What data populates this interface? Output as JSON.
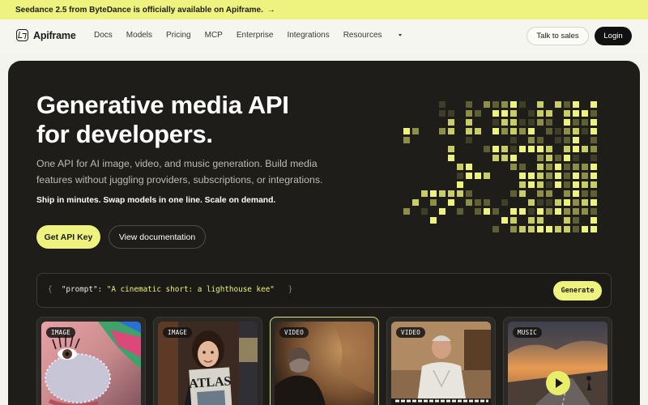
{
  "announcement": {
    "text": "Seedance 2.5 from ByteDance is officially available on Apiframe.",
    "arrow": "→"
  },
  "nav": {
    "brand": "Apiframe",
    "links": [
      "Docs",
      "Models",
      "Pricing",
      "MCP",
      "Enterprise",
      "Integrations",
      "Resources"
    ],
    "talk_to_sales": "Talk to sales",
    "login": "Login"
  },
  "hero": {
    "title_line1": "Generative media API",
    "title_line2": "for developers.",
    "subtitle": "One API for AI image, video, and music generation. Build media features without juggling providers, subscriptions, or integrations.",
    "tagline": "Ship in minutes. Swap models in one line. Scale on demand.",
    "primary_button": "Get API Key",
    "secondary_button": "View documentation"
  },
  "prompt": {
    "open_brace": "{",
    "key": "\"prompt\":",
    "value": "\"A cinematic short: a lighthouse kee\"",
    "close_brace": "}",
    "generate_button": "Generate"
  },
  "cards": [
    {
      "badge": "IMAGE",
      "subject": "face-glitter-portrait"
    },
    {
      "badge": "IMAGE",
      "subject": "woman-holding-atlas-magazine",
      "magazine_text": "ATLAS"
    },
    {
      "badge": "VIDEO",
      "subject": "man-in-cave",
      "active": true
    },
    {
      "badge": "VIDEO",
      "subject": "older-man-at-piano"
    },
    {
      "badge": "MUSIC",
      "subject": "coastal-road-runner",
      "has_play": true
    }
  ],
  "colors": {
    "accent": "#eef27e",
    "hero_bg": "#1e1d1a",
    "page_bg": "#f4f4ef"
  }
}
